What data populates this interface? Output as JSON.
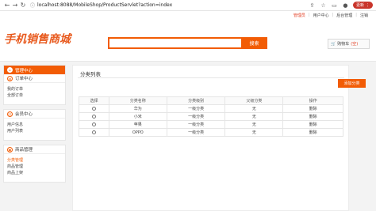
{
  "browser": {
    "url_info": "ⓘ",
    "url": "localhost:8088/MobileShop/ProductServlet?action=index",
    "update_label": "更新"
  },
  "top_links": {
    "admin": "管理员",
    "user_center": "用户中心",
    "backend": "后台管理",
    "logout": "注销"
  },
  "header": {
    "logo": "手机销售商城",
    "search_placeholder": "",
    "search_button": "搜索",
    "cart_label": "购物车",
    "cart_count": "(空)"
  },
  "sidebar": {
    "home": "管理中心",
    "groups": [
      {
        "title": "订单中心",
        "items": [
          "我的订单",
          "全部订单"
        ]
      },
      {
        "title": "会员中心",
        "items": [
          "用户信息",
          "用户列表"
        ]
      },
      {
        "title": "商品管理",
        "items": [
          "分类管理",
          "商品管理",
          "商品上架"
        ]
      }
    ]
  },
  "main": {
    "title": "分类列表",
    "add_button": "添加分类",
    "columns": [
      "选择",
      "分类名称",
      "分类级别",
      "父级分类",
      "操作"
    ],
    "rows": [
      {
        "name": "华为",
        "level": "一级分类",
        "parent": "无",
        "action": "删除"
      },
      {
        "name": "小米",
        "level": "一级分类",
        "parent": "无",
        "action": "删除"
      },
      {
        "name": "苹果",
        "level": "一级分类",
        "parent": "无",
        "action": "删除"
      },
      {
        "name": "OPPO",
        "level": "一级分类",
        "parent": "无",
        "action": "删除"
      }
    ]
  }
}
